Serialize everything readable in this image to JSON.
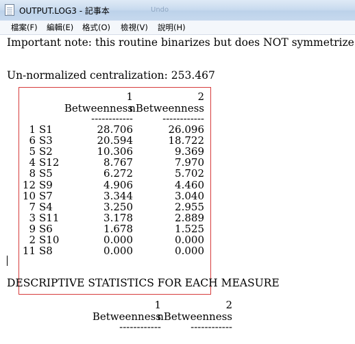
{
  "window": {
    "title": "OUTPUT.LOG3 - 記事本",
    "ghost_label": "Undo"
  },
  "menu": [
    "檔案(F)",
    "編輯(E)",
    "格式(O)",
    "檢視(V)",
    "說明(H)"
  ],
  "content": {
    "note": "Important note: this routine binarizes but does NOT symmetrize.",
    "centralization": "Un-normalized centralization: 253.467",
    "table": {
      "col_numbers": [
        "1",
        "2"
      ],
      "col_headers": [
        "Betweenness",
        "nBetweenness"
      ],
      "separator": "------------",
      "rows": [
        {
          "idx": "1",
          "id": "S1",
          "b": "28.706",
          "nb": "26.096"
        },
        {
          "idx": "6",
          "id": "S3",
          "b": "20.594",
          "nb": "18.722"
        },
        {
          "idx": "5",
          "id": "S2",
          "b": "10.306",
          "nb": "9.369"
        },
        {
          "idx": "4",
          "id": "S12",
          "b": "8.767",
          "nb": "7.970"
        },
        {
          "idx": "8",
          "id": "S5",
          "b": "6.272",
          "nb": "5.702"
        },
        {
          "idx": "12",
          "id": "S9",
          "b": "4.906",
          "nb": "4.460"
        },
        {
          "idx": "10",
          "id": "S7",
          "b": "3.344",
          "nb": "3.040"
        },
        {
          "idx": "7",
          "id": "S4",
          "b": "3.250",
          "nb": "2.955"
        },
        {
          "idx": "3",
          "id": "S11",
          "b": "3.178",
          "nb": "2.889"
        },
        {
          "idx": "9",
          "id": "S6",
          "b": "1.678",
          "nb": "1.525"
        },
        {
          "idx": "2",
          "id": "S10",
          "b": "0.000",
          "nb": "0.000"
        },
        {
          "idx": "11",
          "id": "S8",
          "b": "0.000",
          "nb": "0.000"
        }
      ]
    },
    "desc_heading": "DESCRIPTIVE STATISTICS FOR EACH MEASURE",
    "desc_table": {
      "col_numbers": [
        "1",
        "2"
      ],
      "col_headers": [
        "Betweenness",
        "nBetweenness"
      ],
      "separator": "------------"
    }
  }
}
